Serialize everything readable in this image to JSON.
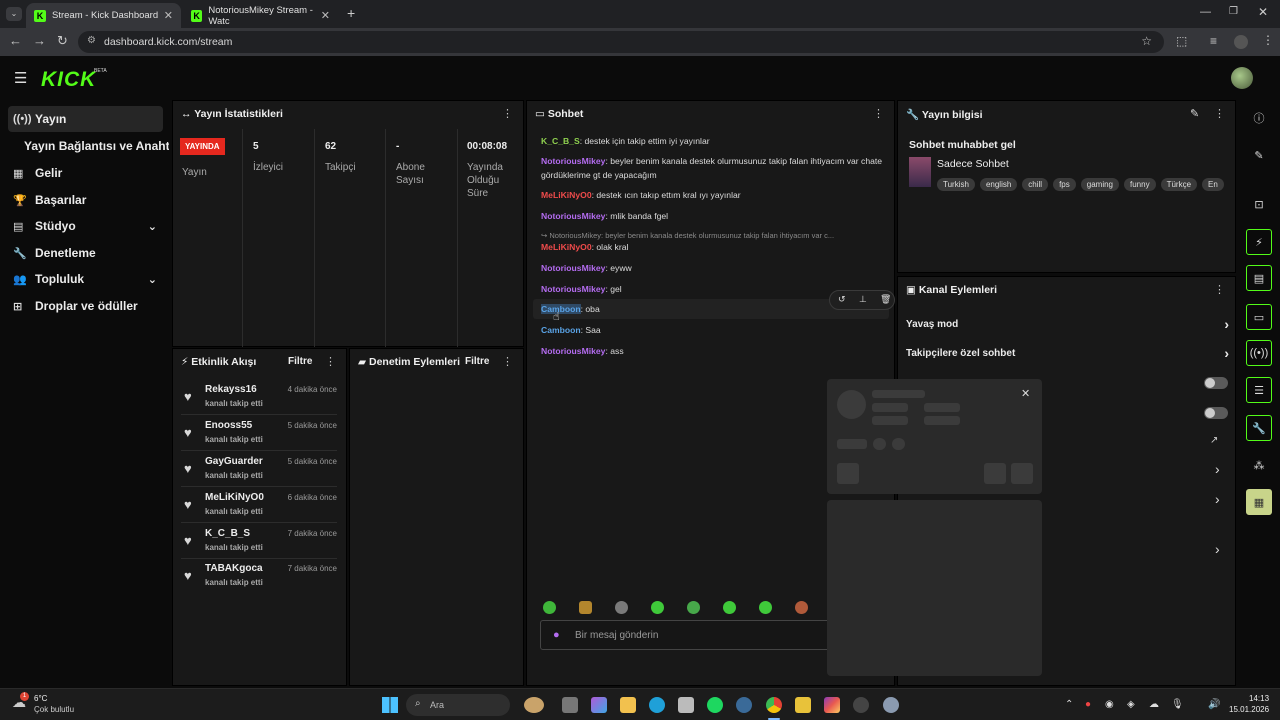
{
  "browser": {
    "tabs": [
      {
        "title": "Stream - Kick Dashboard",
        "active": true
      },
      {
        "title": "NotoriousMikey Stream - Watc",
        "active": false
      }
    ],
    "url": "dashboard.kick.com/stream"
  },
  "header": {
    "logo": "KICK",
    "beta": "BETA"
  },
  "sidebar": {
    "items": [
      {
        "icon": "broadcast-icon",
        "label": "Yayın",
        "active": true
      },
      {
        "icon": "",
        "label": "Yayın Bağlantısı ve Anahtarı"
      },
      {
        "icon": "revenue-icon",
        "label": "Gelir"
      },
      {
        "icon": "trophy-icon",
        "label": "Başarılar"
      },
      {
        "icon": "studio-icon",
        "label": "Stüdyo",
        "expandable": true
      },
      {
        "icon": "wrench-icon",
        "label": "Denetleme"
      },
      {
        "icon": "community-icon",
        "label": "Topluluk",
        "expandable": true
      },
      {
        "icon": "drops-icon",
        "label": "Droplar ve ödüller"
      }
    ]
  },
  "stats": {
    "title": "Yayın İstatistikleri",
    "live_badge": "YAYINDA",
    "live_label": "Yayın",
    "cols": [
      {
        "value": "5",
        "label": "İzleyici"
      },
      {
        "value": "62",
        "label": "Takipçi"
      },
      {
        "value": "-",
        "label": "Abone Sayısı"
      },
      {
        "value": "00:08:08",
        "label": "Yayında Olduğu Süre"
      }
    ]
  },
  "chat": {
    "title": "Sohbet",
    "messages": [
      {
        "user": "K_C_B_S",
        "color": "gr",
        "text": ": destek için takip ettim iyi yayınlar"
      },
      {
        "user": "NotoriousMikey",
        "color": "pu",
        "text": ": beyler benim kanala destek olurmusunuz takip falan ihtiyacım var chate gördüklerime gt de yapacağım"
      },
      {
        "user": "MeLiKiNyO0",
        "color": "re",
        "text": ": destek ıcın takıp ettım kral ıyı yayınlar"
      },
      {
        "user": "NotoriousMikey",
        "color": "pu",
        "text": ": mlik banda fgel"
      },
      {
        "reply": "↪ NotoriousMikey: beyler benim kanala destek olurmusunuz takip falan ihtiyacım var c...",
        "user": "MeLiKiNyO0",
        "color": "re",
        "text": ": olak kral"
      },
      {
        "user": "NotoriousMikey",
        "color": "pu",
        "text": ": eyww"
      },
      {
        "user": "NotoriousMikey",
        "color": "pu",
        "text": ": gel"
      },
      {
        "user": "Camboon",
        "color": "bl",
        "text": ": oba"
      },
      {
        "user": "Camboon",
        "color": "bl",
        "text": ": Saa"
      },
      {
        "user": "NotoriousMikey",
        "color": "pu",
        "text": ": ass"
      }
    ],
    "input_placeholder": "Bir mesaj gönderin"
  },
  "stream_info": {
    "title": "Yayın bilgisi",
    "stream_title": "Sohbet muhabbet gel",
    "category": "Sadece Sohbet",
    "tags": [
      "Turkish",
      "english",
      "chill",
      "fps",
      "gaming",
      "funny",
      "Türkçe",
      "En"
    ]
  },
  "channel_actions": {
    "title": "Kanal Eylemleri",
    "items": [
      "Yavaş mod",
      "Takipçilere özel sohbet"
    ]
  },
  "activity": {
    "title": "Etkinlik Akışı",
    "filter": "Filtre",
    "items": [
      {
        "name": "Rekayss16",
        "sub": "kanalı takip etti",
        "time": "4 dakika önce"
      },
      {
        "name": "Enooss55",
        "sub": "kanalı takip etti",
        "time": "5 dakika önce"
      },
      {
        "name": "GayGuarder",
        "sub": "kanalı takip etti",
        "time": "5 dakika önce"
      },
      {
        "name": "MeLiKiNyO0",
        "sub": "kanalı takip etti",
        "time": "6 dakika önce"
      },
      {
        "name": "K_C_B_S",
        "sub": "kanalı takip etti",
        "time": "7 dakika önce"
      },
      {
        "name": "TABAKgoca",
        "sub": "kanalı takip etti",
        "time": "7 dakika önce"
      }
    ]
  },
  "moderation": {
    "title": "Denetim Eylemleri",
    "filter": "Filtre"
  },
  "taskbar": {
    "weather_temp": "6°C",
    "weather_desc": "Çok bulutlu",
    "search": "Ara",
    "time": "14:13",
    "date": "15.01.2026"
  }
}
